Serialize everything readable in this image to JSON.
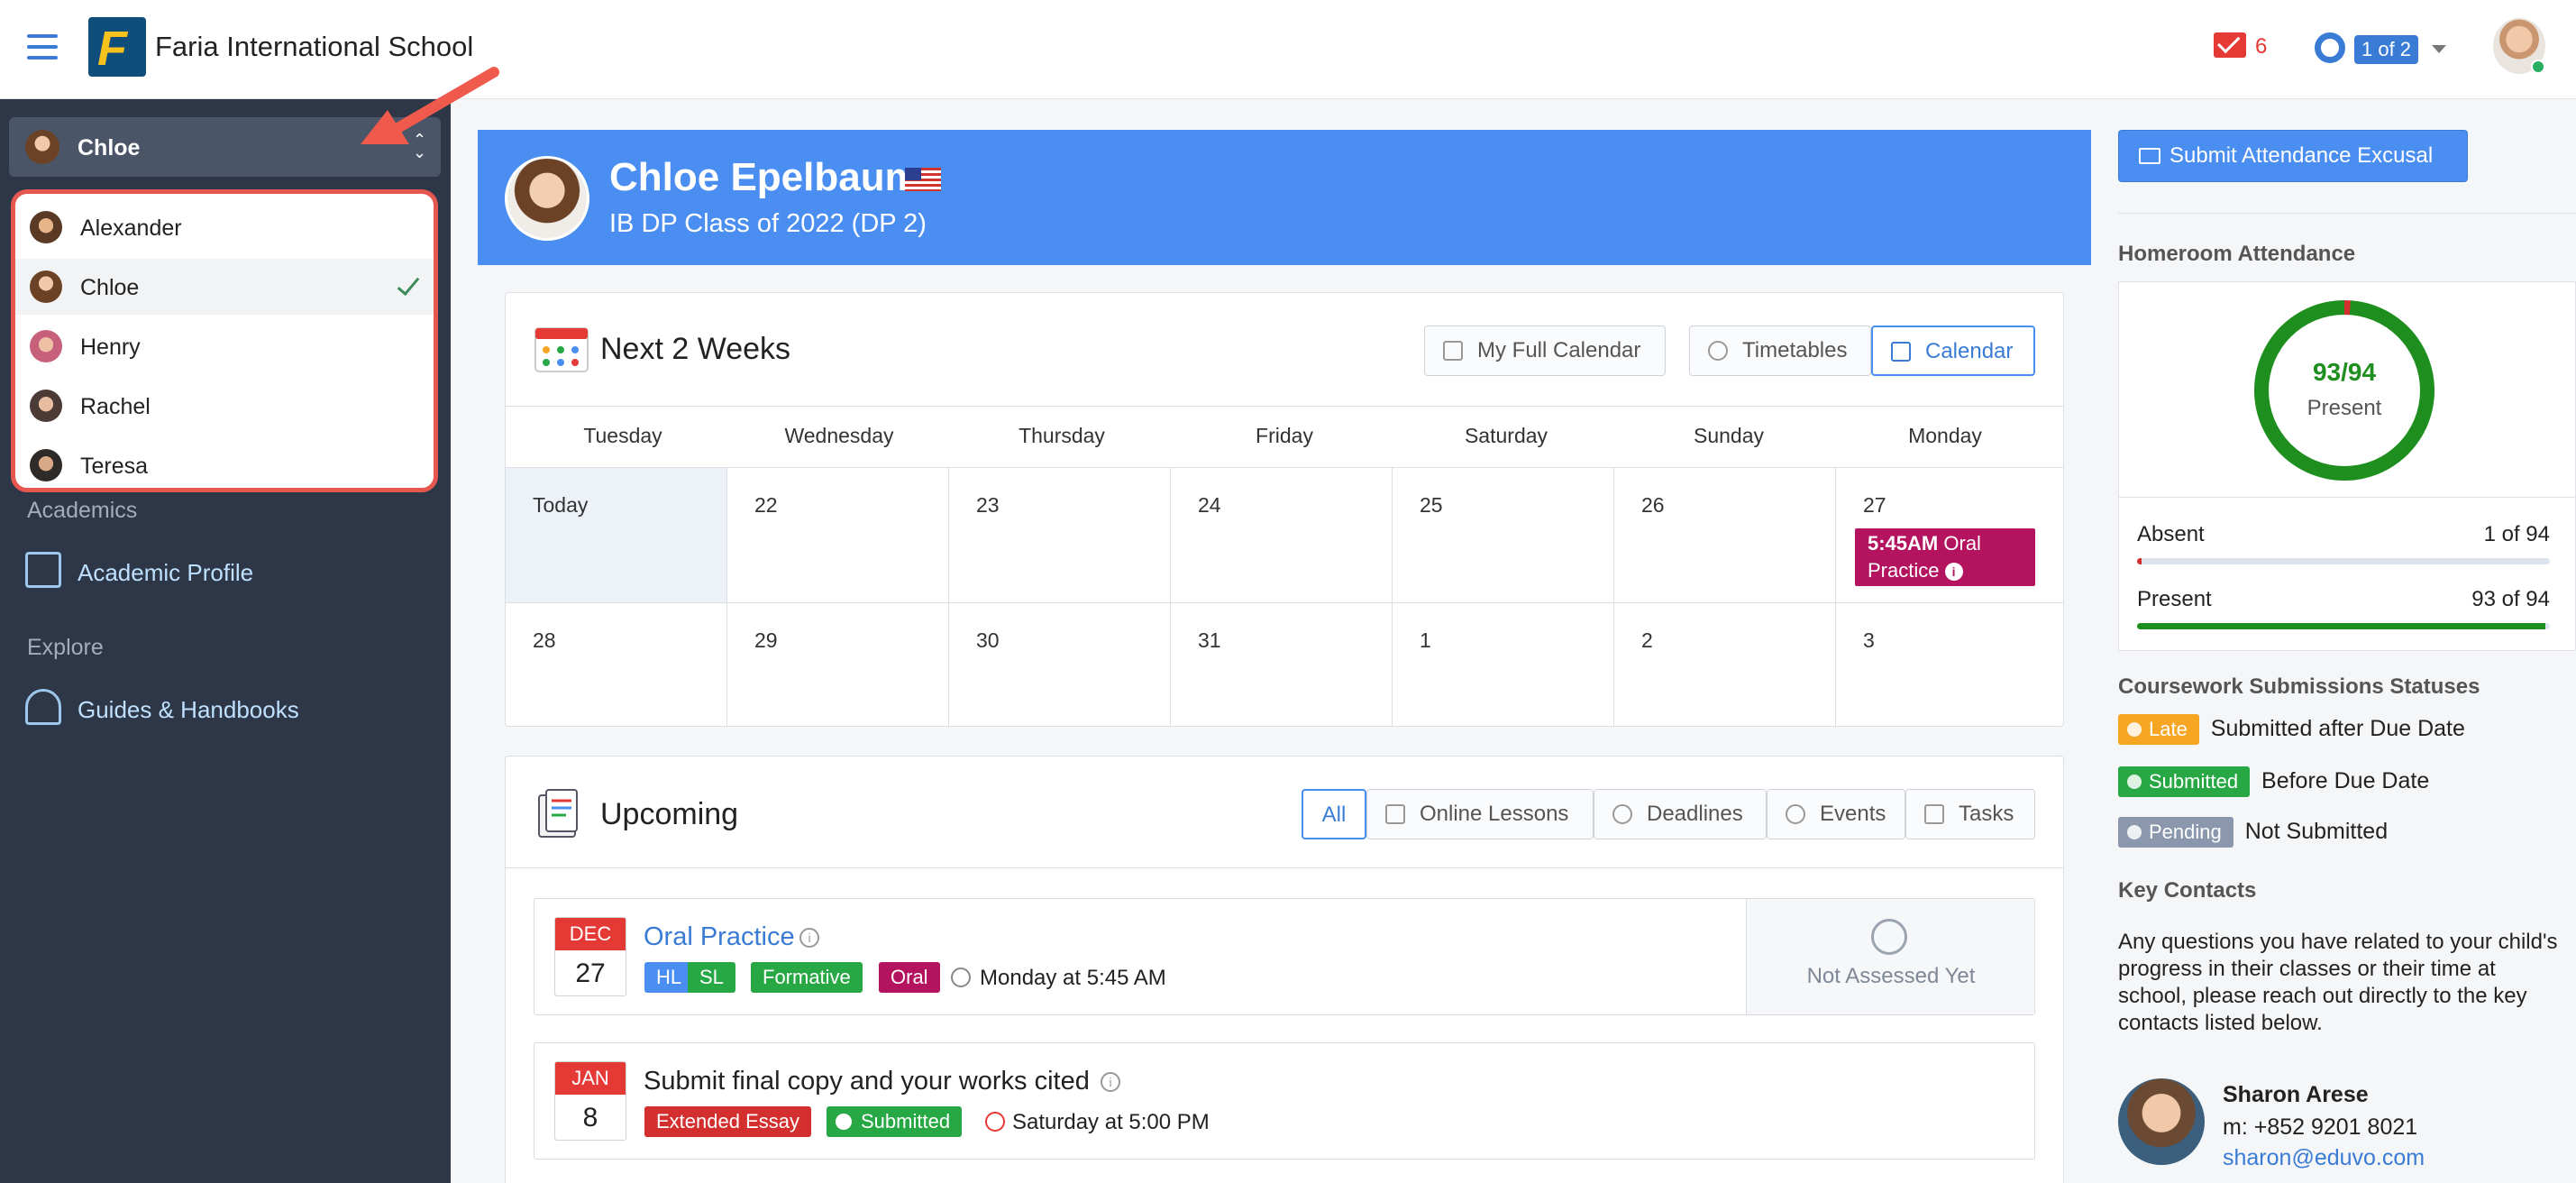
{
  "header": {
    "school_name": "Faria International School",
    "mail_count": "6",
    "page_badge": "1 of 2"
  },
  "sidebar": {
    "selected_child": "Chloe",
    "children": [
      {
        "name": "Alexander",
        "selected": false
      },
      {
        "name": "Chloe",
        "selected": true
      },
      {
        "name": "Henry",
        "selected": false
      },
      {
        "name": "Rachel",
        "selected": false
      },
      {
        "name": "Teresa",
        "selected": false
      }
    ],
    "sections": [
      {
        "label": "Academics",
        "link": "Academic Profile"
      },
      {
        "label": "Explore",
        "link": "Guides & Handbooks"
      }
    ]
  },
  "student": {
    "name": "Chloe Epelbaum",
    "class": "IB DP Class of 2022 (DP 2)"
  },
  "calendar": {
    "title": "Next 2 Weeks",
    "buttons": {
      "full": "My Full Calendar",
      "timetables": "Timetables",
      "calendar": "Calendar"
    },
    "days": [
      "Tuesday",
      "Wednesday",
      "Thursday",
      "Friday",
      "Saturday",
      "Sunday",
      "Monday"
    ],
    "week1": [
      "Today",
      "22",
      "23",
      "24",
      "25",
      "26",
      "27"
    ],
    "week2": [
      "28",
      "29",
      "30",
      "31",
      "1",
      "2",
      "3"
    ],
    "event": {
      "time": "5:45AM",
      "title": "Oral Practice"
    }
  },
  "upcoming": {
    "title": "Upcoming",
    "filters": [
      "All",
      "Online Lessons",
      "Deadlines",
      "Events",
      "Tasks"
    ],
    "items": [
      {
        "month": "DEC",
        "day": "27",
        "title": "Oral Practice",
        "tags": [
          "HL",
          "SL",
          "Formative",
          "Oral"
        ],
        "when": "Monday at 5:45 AM",
        "status": "Not Assessed Yet"
      },
      {
        "month": "JAN",
        "day": "8",
        "title": "Submit final copy and your works cited",
        "tags": [
          "Extended Essay",
          "Submitted"
        ],
        "when": "Saturday at 5:00 PM"
      }
    ]
  },
  "right_panel": {
    "excusal_button": "Submit Attendance Excusal",
    "attendance": {
      "heading": "Homeroom Attendance",
      "ring_value": "93/94",
      "ring_label": "Present",
      "absent_label": "Absent",
      "absent_value": "1 of 94",
      "absent_fraction": 0.0106,
      "present_label": "Present",
      "present_value": "93 of 94",
      "present_fraction": 0.9894
    },
    "coursework": {
      "heading": "Coursework Submissions Statuses",
      "legend": [
        {
          "tag": "Late",
          "text": "Submitted after Due Date",
          "color": "#f6a623"
        },
        {
          "tag": "Submitted",
          "text": "Before Due Date",
          "color": "#27a844"
        },
        {
          "tag": "Pending",
          "text": "Not Submitted",
          "color": "#8a97ac"
        }
      ]
    },
    "contacts": {
      "heading": "Key Contacts",
      "text": "Any questions you have related to your child's progress in their classes or their time at school, please reach out directly to the key contacts listed below.",
      "name": "Sharon Arese",
      "phone": "m: +852 9201 8021",
      "email": "sharon@eduvo.com"
    }
  },
  "colors": {
    "accent": "#4a8ef2",
    "sidebar": "#2d3748",
    "highlight_border": "#e5574f",
    "event": "#b3135f",
    "present": "#1e8e1e",
    "absent": "#d32f2f"
  }
}
